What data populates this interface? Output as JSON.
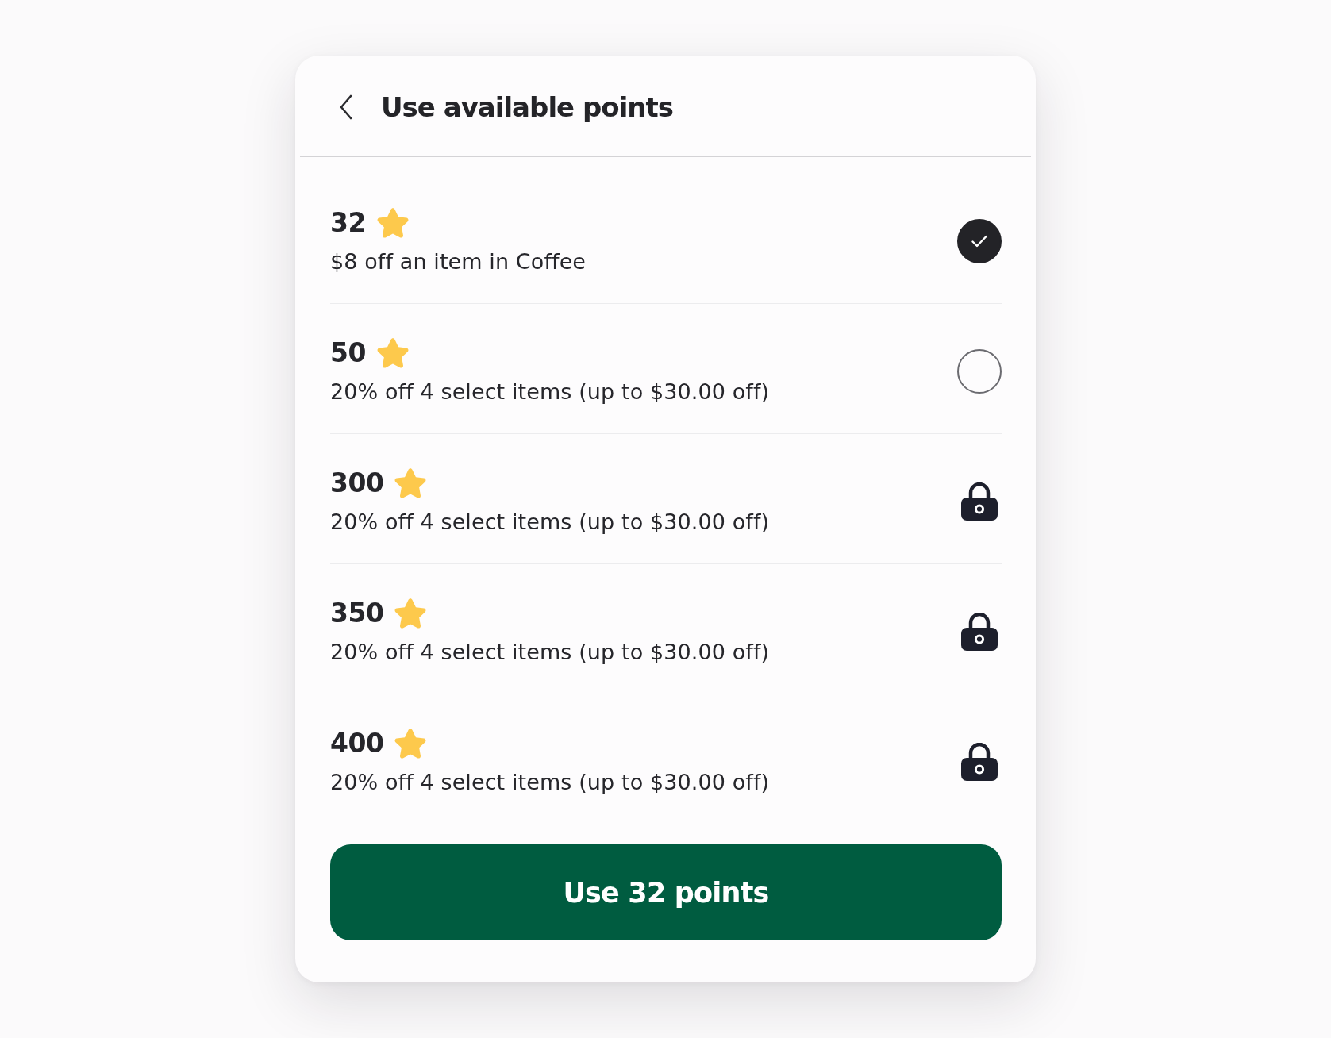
{
  "header": {
    "title": "Use available points"
  },
  "rewards": [
    {
      "kind": "available",
      "points": "32",
      "description": "$8 off an item in Coffee",
      "selected": true
    },
    {
      "kind": "available",
      "points": "50",
      "description": "20% off 4 select items (up to $30.00 off)",
      "selected": false
    },
    {
      "kind": "locked",
      "points": "300",
      "description": "20% off 4 select items (up to $30.00 off)",
      "selected": false
    },
    {
      "kind": "locked",
      "points": "350",
      "description": "20% off 4 select items (up to $30.00 off)",
      "selected": false
    },
    {
      "kind": "locked",
      "points": "400",
      "description": "20% off 4 select items (up to $30.00 off)",
      "selected": false
    }
  ],
  "button": {
    "label": "Use 32 points"
  }
}
